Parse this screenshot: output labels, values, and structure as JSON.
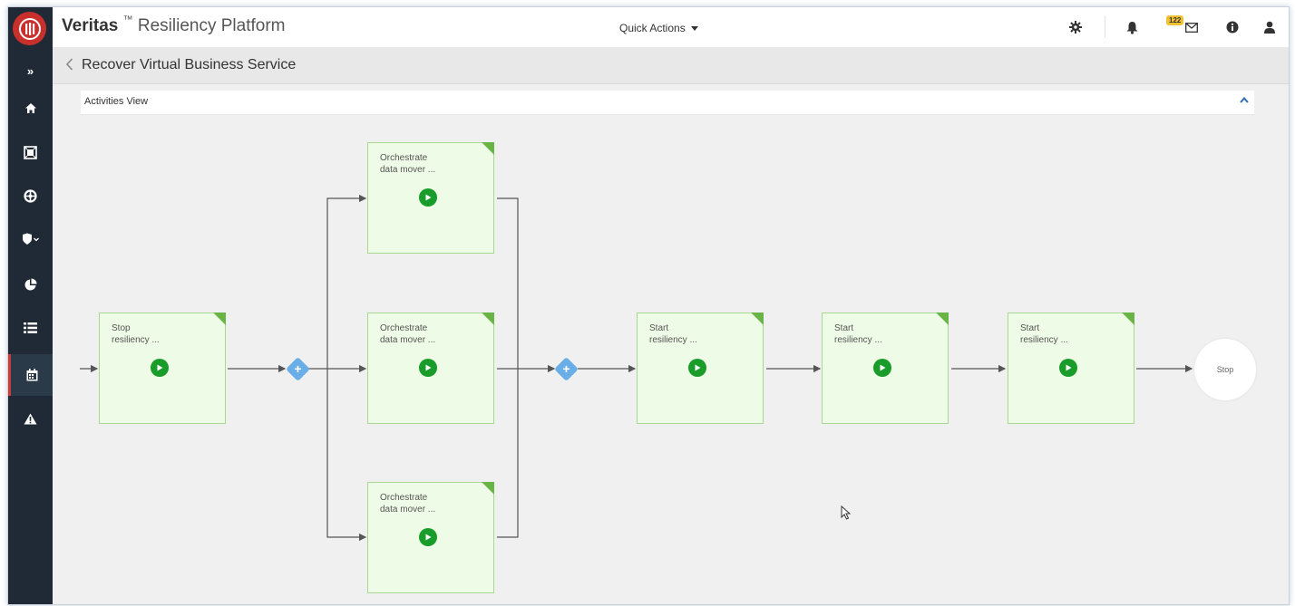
{
  "header": {
    "brand": "Veritas",
    "trademark": "™",
    "product": "Resiliency Platform",
    "quick_actions_label": "Quick Actions",
    "notification_count": "122",
    "icons": [
      "gear-icon",
      "bell-icon",
      "envelope-icon",
      "info-icon",
      "user-icon"
    ]
  },
  "sidebar": {
    "items": [
      {
        "icon": "expand-icon"
      },
      {
        "icon": "home-icon"
      },
      {
        "icon": "assets-icon"
      },
      {
        "icon": "lifebuoy-icon"
      },
      {
        "icon": "shield-icon"
      },
      {
        "icon": "reports-icon"
      },
      {
        "icon": "list-icon"
      },
      {
        "icon": "calendar-icon",
        "active": true
      },
      {
        "icon": "warning-icon"
      }
    ]
  },
  "page": {
    "title": "Recover Virtual Business Service",
    "panel_title": "Activities View"
  },
  "workflow": {
    "nodes": [
      {
        "label": "Stop\nresiliency ..."
      },
      {
        "label": "Orchestrate\ndata mover ..."
      },
      {
        "label": "Orchestrate\ndata mover ..."
      },
      {
        "label": "Orchestrate\ndata mover ..."
      },
      {
        "label": "Start\nresiliency ..."
      },
      {
        "label": "Start\nresiliency ..."
      },
      {
        "label": "Start\nresiliency ..."
      }
    ],
    "end_label": "Stop"
  },
  "colors": {
    "sidebar_bg": "#1f2a36",
    "node_fill": "#eefbe6",
    "node_border": "#a9d991",
    "play_green": "#199c2a",
    "gate_blue": "#6aaee8",
    "logo_red": "#c9302c",
    "badge_yellow": "#f2c132"
  }
}
